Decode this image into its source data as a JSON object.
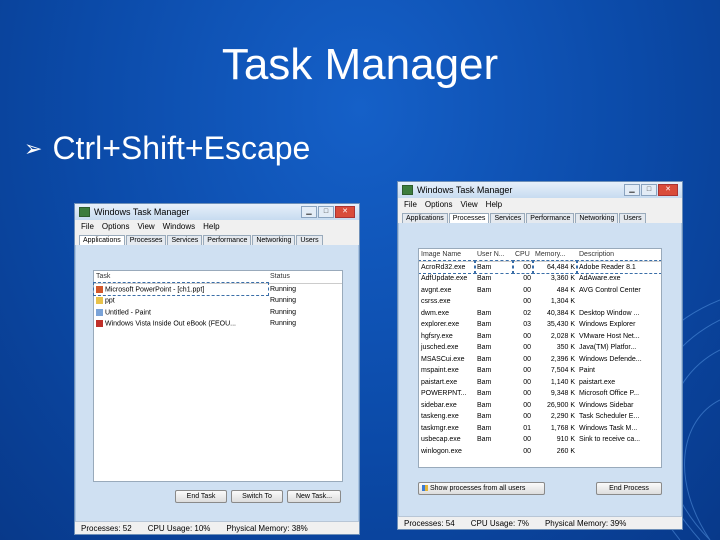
{
  "slide": {
    "title": "Task Manager",
    "bullet": "Ctrl+Shift+Escape",
    "bullet_arrow": "➢"
  },
  "left_window": {
    "title": "Windows Task Manager",
    "controls": [
      "▁",
      "□",
      "✕"
    ],
    "menu": [
      "File",
      "Options",
      "View",
      "Windows",
      "Help"
    ],
    "tabs": [
      "Applications",
      "Processes",
      "Services",
      "Performance",
      "Networking",
      "Users"
    ],
    "headers": {
      "task": "Task",
      "status": "Status"
    },
    "tasks": [
      {
        "name": "Microsoft PowerPoint - [ch1.ppt]",
        "status": "Running",
        "icon": "#d2572a"
      },
      {
        "name": "ppt",
        "status": "Running",
        "icon": "#e8c24a"
      },
      {
        "name": "Untitled - Paint",
        "status": "Running",
        "icon": "#7aa3d8"
      },
      {
        "name": "Windows Vista Inside Out eBook (FEOU...",
        "status": "Running",
        "icon": "#c0302a"
      }
    ],
    "buttons": {
      "end": "End Task",
      "switch": "Switch To",
      "new": "New Task..."
    },
    "status": {
      "processes": "Processes: 52",
      "cpu": "CPU Usage: 10%",
      "memory": "Physical Memory: 38%"
    }
  },
  "right_window": {
    "title": "Windows Task Manager",
    "controls": [
      "▁",
      "□",
      "✕"
    ],
    "menu": [
      "File",
      "Options",
      "View",
      "Help"
    ],
    "tabs": [
      "Applications",
      "Processes",
      "Services",
      "Performance",
      "Networking",
      "Users"
    ],
    "headers": {
      "image": "Image Name",
      "user": "User N...",
      "cpu": "CPU",
      "mem": "Memory...",
      "desc": "Description"
    },
    "processes": [
      {
        "image": "AcroRd32.exe",
        "user": "Bam",
        "cpu": "00",
        "mem": "64,484 K",
        "desc": "Adobe Reader 8.1"
      },
      {
        "image": "AdfUpdate.exe",
        "user": "Bam",
        "cpu": "00",
        "mem": "3,360 K",
        "desc": "AdAware.exe"
      },
      {
        "image": "avgnt.exe",
        "user": "Bam",
        "cpu": "00",
        "mem": "484 K",
        "desc": "AVG Control Center"
      },
      {
        "image": "csrss.exe",
        "user": "",
        "cpu": "00",
        "mem": "1,304 K",
        "desc": ""
      },
      {
        "image": "dwm.exe",
        "user": "Bam",
        "cpu": "02",
        "mem": "40,384 K",
        "desc": "Desktop Window ..."
      },
      {
        "image": "explorer.exe",
        "user": "Bam",
        "cpu": "03",
        "mem": "35,430 K",
        "desc": "Windows Explorer"
      },
      {
        "image": "hgfsry.exe",
        "user": "Bam",
        "cpu": "00",
        "mem": "2,028 K",
        "desc": "VMware Host Net..."
      },
      {
        "image": "jusched.exe",
        "user": "Bam",
        "cpu": "00",
        "mem": "350 K",
        "desc": "Java(TM) Platfor..."
      },
      {
        "image": "MSASCui.exe",
        "user": "Bam",
        "cpu": "00",
        "mem": "2,396 K",
        "desc": "Windows Defende..."
      },
      {
        "image": "mspaint.exe",
        "user": "Bam",
        "cpu": "00",
        "mem": "7,504 K",
        "desc": "Paint"
      },
      {
        "image": "paistart.exe",
        "user": "Bam",
        "cpu": "00",
        "mem": "1,140 K",
        "desc": "paistart.exe"
      },
      {
        "image": "POWERPNT...",
        "user": "Bam",
        "cpu": "00",
        "mem": "9,348 K",
        "desc": "Microsoft Office P..."
      },
      {
        "image": "sidebar.exe",
        "user": "Bam",
        "cpu": "00",
        "mem": "26,900 K",
        "desc": "Windows Sidebar"
      },
      {
        "image": "taskeng.exe",
        "user": "Bam",
        "cpu": "00",
        "mem": "2,290 K",
        "desc": "Task Scheduler E..."
      },
      {
        "image": "taskmgr.exe",
        "user": "Bam",
        "cpu": "01",
        "mem": "1,768 K",
        "desc": "Windows Task M..."
      },
      {
        "image": "usbecap.exe",
        "user": "Bam",
        "cpu": "00",
        "mem": "910 K",
        "desc": "Sink to receive ca..."
      },
      {
        "image": "winlogon.exe",
        "user": "",
        "cpu": "00",
        "mem": "260 K",
        "desc": ""
      }
    ],
    "show_all": "Show processes from all users",
    "end_process": "End Process",
    "status": {
      "processes": "Processes: 54",
      "cpu": "CPU Usage: 7%",
      "memory": "Physical Memory: 39%"
    }
  }
}
